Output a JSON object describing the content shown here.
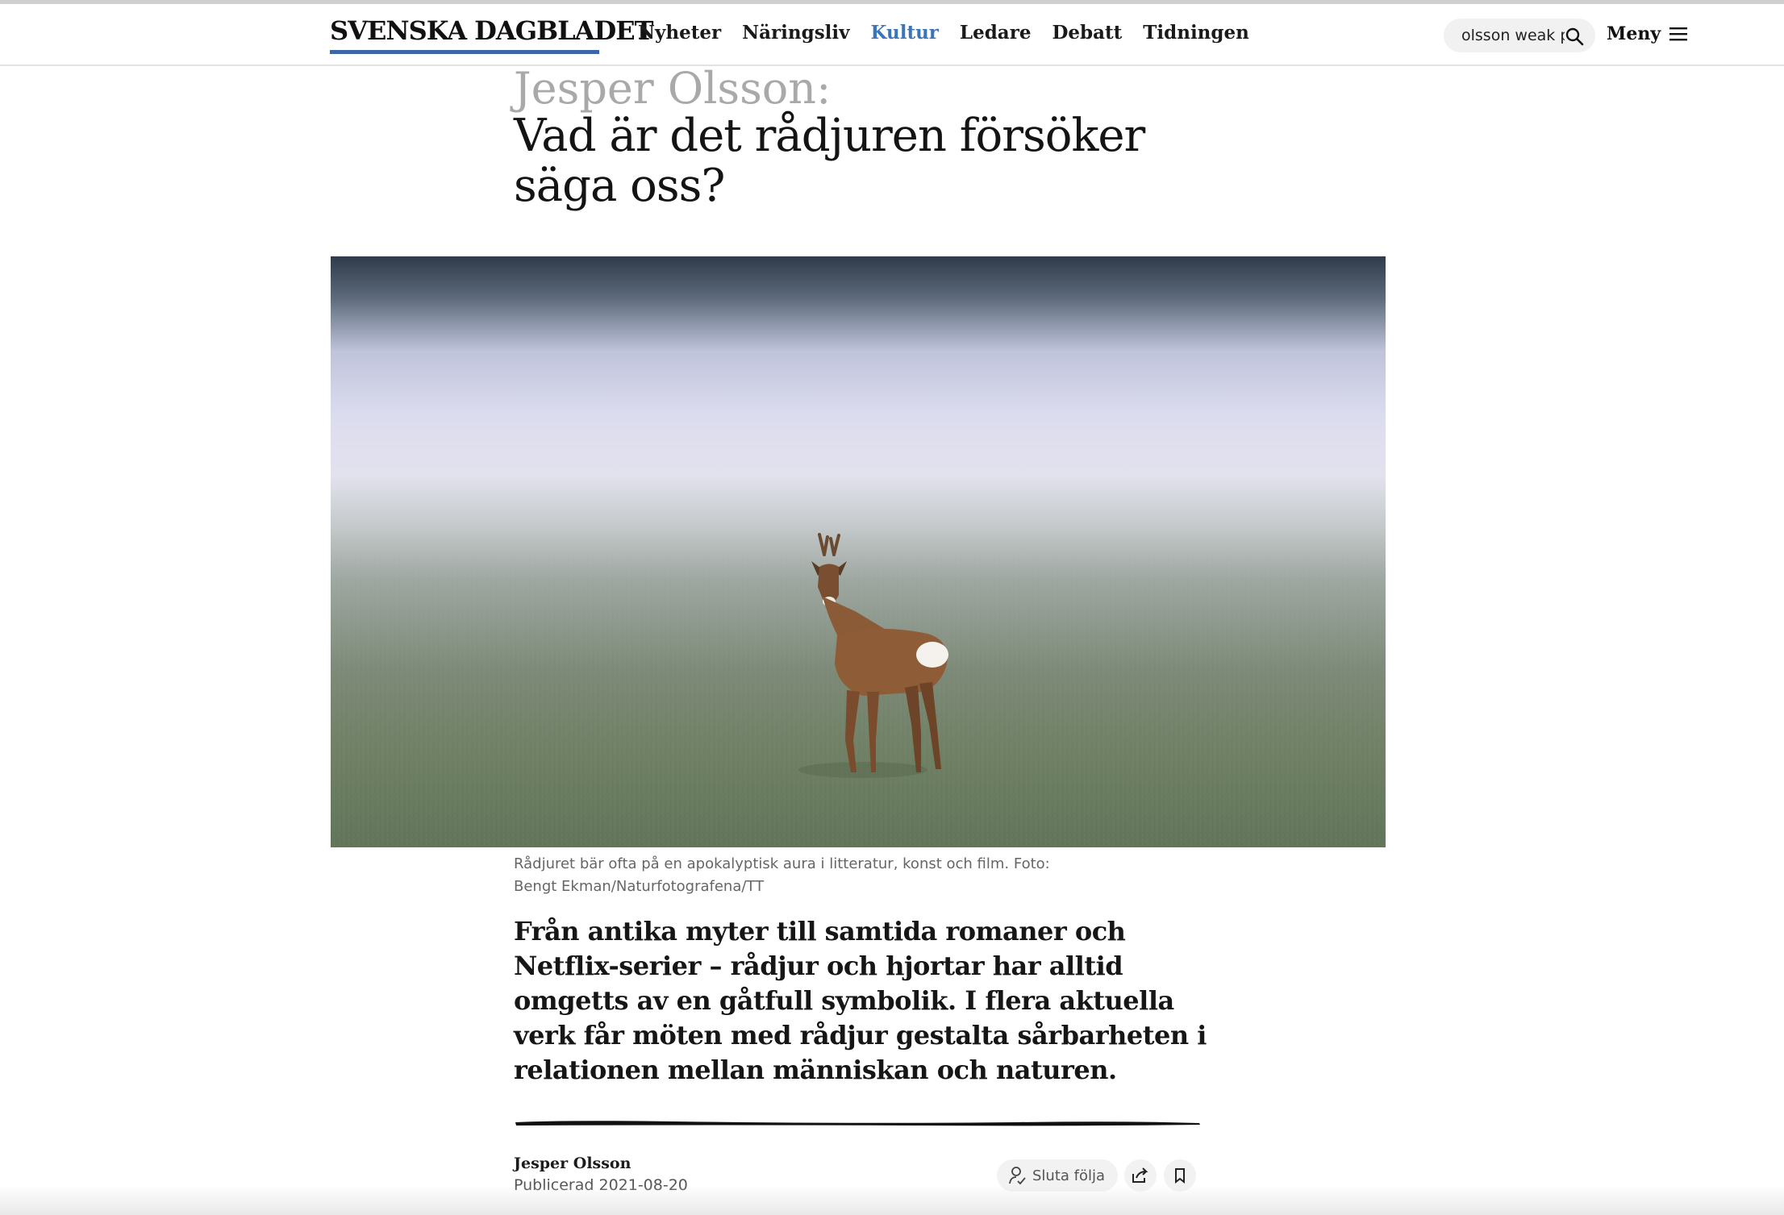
{
  "site": {
    "logo_text": "SVENSKA DAGBLADET",
    "nav": [
      {
        "label": "Nyheter",
        "active": false
      },
      {
        "label": "Näringsliv",
        "active": false
      },
      {
        "label": "Kultur",
        "active": true
      },
      {
        "label": "Ledare",
        "active": false
      },
      {
        "label": "Debatt",
        "active": false
      },
      {
        "label": "Tidningen",
        "active": false
      }
    ],
    "search_value": "olsson weak p",
    "menu_label": "Meny",
    "brand_color": "#3c66a8",
    "active_nav_color": "#3c74b8"
  },
  "article": {
    "kicker": "Jesper Olsson:",
    "title": "Vad är det rådjuren försöker säga oss?",
    "image_caption": "Rådjuret bär ofta på en apokalyptisk aura i litteratur, konst och film. Foto: Bengt Ekman/Naturfotografena/TT",
    "lead": "Från antika myter till samtida romaner och Netflix-serier – rådjur och hjortar har alltid omgetts av en gåtfull symbolik. I flera aktuella verk får möten med rådjur gestalta sårbarheten i relationen mellan människan och naturen.",
    "author": "Jesper Olsson",
    "published": "Publicerad 2021-08-20"
  },
  "actions": {
    "follow_label": "Sluta följa",
    "share_icon": "share-icon",
    "bookmark_icon": "bookmark-icon"
  }
}
